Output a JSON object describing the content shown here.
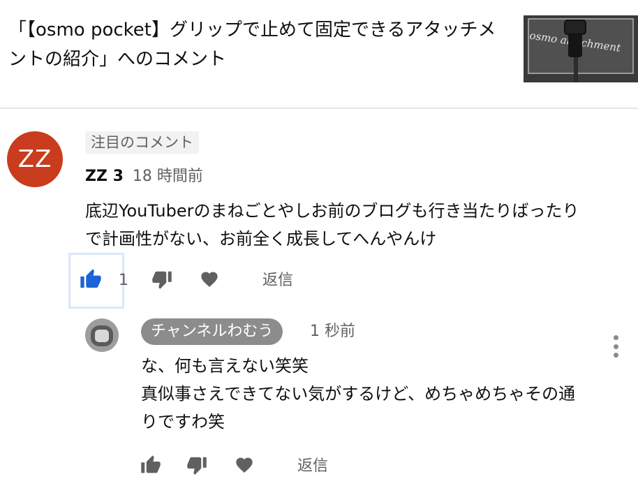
{
  "header": {
    "title": "「【osmo pocket】グリップで止めて固定できるアタッチメントの紹介」へのコメント",
    "thumbnail_caption": "osmo attachment"
  },
  "comment": {
    "avatar_initials": "ZZ",
    "avatar_color": "#c93c1e",
    "pinned_label": "注目のコメント",
    "author": "ZZ 3",
    "time": "18 時間前",
    "body": "底辺YouTuberのまねごとやしお前のブログも行き当たりばったりで計画性がない、お前全く成長してへんやんけ",
    "like_count": "1",
    "reply_label": "返信",
    "like_icon_color": "#1a64d6"
  },
  "reply": {
    "author": "チャンネルわむう",
    "time": "1 秒前",
    "body": "な、何も言えない笑笑\n真似事さえできてない気がするけど、めちゃめちゃその通りですわ笑",
    "reply_label": "返信"
  },
  "icons": {
    "like": "thumbs-up-icon",
    "dislike": "thumbs-down-icon",
    "heart": "heart-icon",
    "more": "kebab-menu-icon"
  }
}
